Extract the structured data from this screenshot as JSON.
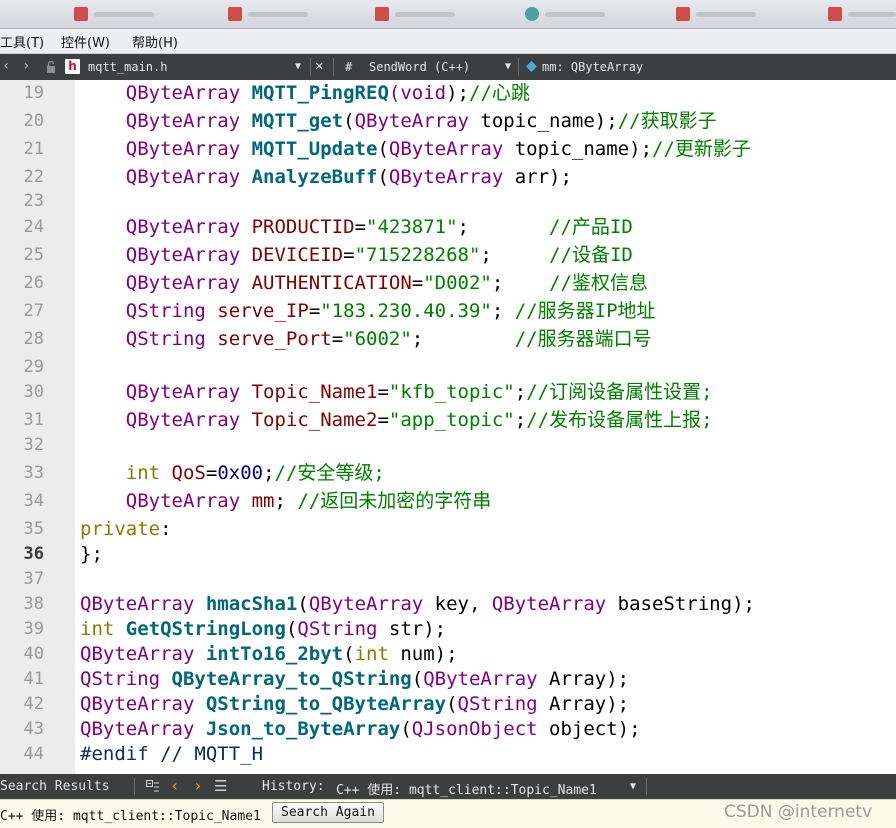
{
  "menu": [
    "工具(T)",
    "控件(W)",
    "帮助(H)"
  ],
  "editorbar": {
    "filename": "mqtt_main.h",
    "symbol_prefix": "#",
    "symbol": "SendWord (C++)",
    "member": "mm: QByteArray"
  },
  "code_lines": [
    {
      "n": "19",
      "current": false,
      "tokens": [
        [
          "    ",
          ""
        ],
        [
          "QByteArray",
          "type"
        ],
        [
          " ",
          ""
        ],
        [
          "MQTT_PingREQ",
          "func"
        ],
        [
          "(",
          "type"
        ],
        [
          "void",
          "type"
        ],
        [
          ");",
          ""
        ],
        [
          "//心跳",
          "com"
        ]
      ]
    },
    {
      "n": "20",
      "current": false,
      "tokens": [
        [
          "    ",
          ""
        ],
        [
          "QByteArray",
          "type"
        ],
        [
          " ",
          ""
        ],
        [
          "MQTT_get",
          "func"
        ],
        [
          "(",
          ""
        ],
        [
          "QByteArray",
          "type"
        ],
        [
          " topic_name);",
          ""
        ],
        [
          "//获取影子",
          "com"
        ]
      ]
    },
    {
      "n": "21",
      "current": false,
      "tokens": [
        [
          "    ",
          ""
        ],
        [
          "QByteArray",
          "type"
        ],
        [
          " ",
          ""
        ],
        [
          "MQTT_Update",
          "func"
        ],
        [
          "(",
          ""
        ],
        [
          "QByteArray",
          "type"
        ],
        [
          " topic_name);",
          ""
        ],
        [
          "//更新影子",
          "com"
        ]
      ]
    },
    {
      "n": "22",
      "current": false,
      "tokens": [
        [
          "    ",
          ""
        ],
        [
          "QByteArray",
          "type"
        ],
        [
          " ",
          ""
        ],
        [
          "AnalyzeBuff",
          "func"
        ],
        [
          "(",
          ""
        ],
        [
          "QByteArray",
          "type"
        ],
        [
          " arr);",
          ""
        ]
      ]
    },
    {
      "n": "23",
      "current": false,
      "tokens": []
    },
    {
      "n": "24",
      "current": false,
      "tokens": [
        [
          "    ",
          ""
        ],
        [
          "QByteArray",
          "type"
        ],
        [
          " ",
          ""
        ],
        [
          "PRODUCTID",
          "var"
        ],
        [
          "=",
          ""
        ],
        [
          "\"423871\"",
          "str"
        ],
        [
          ";       ",
          ""
        ],
        [
          "//产品ID",
          "com"
        ]
      ]
    },
    {
      "n": "25",
      "current": false,
      "tokens": [
        [
          "    ",
          ""
        ],
        [
          "QByteArray",
          "type"
        ],
        [
          " ",
          ""
        ],
        [
          "DEVICEID",
          "var"
        ],
        [
          "=",
          ""
        ],
        [
          "\"715228268\"",
          "str"
        ],
        [
          ";     ",
          ""
        ],
        [
          "//设备ID",
          "com"
        ]
      ]
    },
    {
      "n": "26",
      "current": false,
      "tokens": [
        [
          "    ",
          ""
        ],
        [
          "QByteArray",
          "type"
        ],
        [
          " ",
          ""
        ],
        [
          "AUTHENTICATION",
          "var"
        ],
        [
          "=",
          ""
        ],
        [
          "\"D002\"",
          "str"
        ],
        [
          ";    ",
          ""
        ],
        [
          "//鉴权信息",
          "com"
        ]
      ]
    },
    {
      "n": "27",
      "current": false,
      "tokens": [
        [
          "    ",
          ""
        ],
        [
          "QString",
          "type"
        ],
        [
          " ",
          ""
        ],
        [
          "serve_IP",
          "var"
        ],
        [
          "=",
          ""
        ],
        [
          "\"183.230.40.39\"",
          "str"
        ],
        [
          "; ",
          ""
        ],
        [
          "//服务器IP地址",
          "com"
        ]
      ]
    },
    {
      "n": "28",
      "current": false,
      "tokens": [
        [
          "    ",
          ""
        ],
        [
          "QString",
          "type"
        ],
        [
          " ",
          ""
        ],
        [
          "serve_Port",
          "var"
        ],
        [
          "=",
          ""
        ],
        [
          "\"6002\"",
          "str"
        ],
        [
          ";        ",
          ""
        ],
        [
          "//服务器端口号",
          "com"
        ]
      ]
    },
    {
      "n": "29",
      "current": false,
      "tokens": []
    },
    {
      "n": "30",
      "current": false,
      "tokens": [
        [
          "    ",
          ""
        ],
        [
          "QByteArray",
          "type"
        ],
        [
          " ",
          ""
        ],
        [
          "Topic_Name1",
          "var"
        ],
        [
          "=",
          ""
        ],
        [
          "\"kfb_topic\"",
          "str"
        ],
        [
          ";",
          ""
        ],
        [
          "//订阅设备属性设置;",
          "com"
        ]
      ]
    },
    {
      "n": "31",
      "current": false,
      "tokens": [
        [
          "    ",
          ""
        ],
        [
          "QByteArray",
          "type"
        ],
        [
          " ",
          ""
        ],
        [
          "Topic_Name2",
          "var"
        ],
        [
          "=",
          ""
        ],
        [
          "\"app_topic\"",
          "str"
        ],
        [
          ";",
          ""
        ],
        [
          "//发布设备属性上报;",
          "com"
        ]
      ]
    },
    {
      "n": "32",
      "current": false,
      "tokens": []
    },
    {
      "n": "33",
      "current": false,
      "tokens": [
        [
          "    ",
          ""
        ],
        [
          "int",
          "kw"
        ],
        [
          " ",
          ""
        ],
        [
          "QoS",
          "var"
        ],
        [
          "=",
          ""
        ],
        [
          "0x00",
          "num"
        ],
        [
          ";",
          ""
        ],
        [
          "//安全等级;",
          "com"
        ]
      ]
    },
    {
      "n": "34",
      "current": false,
      "tokens": [
        [
          "    ",
          ""
        ],
        [
          "QByteArray",
          "type"
        ],
        [
          " ",
          ""
        ],
        [
          "mm",
          "var"
        ],
        [
          "; ",
          ""
        ],
        [
          "//返回未加密的字符串",
          "com"
        ]
      ]
    },
    {
      "n": "35",
      "current": false,
      "tokens": [
        [
          "private",
          "kw"
        ],
        [
          ":",
          ""
        ]
      ]
    },
    {
      "n": "36",
      "current": true,
      "tokens": [
        [
          "};",
          ""
        ]
      ]
    },
    {
      "n": "37",
      "current": false,
      "tokens": []
    },
    {
      "n": "38",
      "current": false,
      "tokens": [
        [
          "QByteArray",
          "type"
        ],
        [
          " ",
          ""
        ],
        [
          "hmacSha1",
          "func"
        ],
        [
          "(",
          ""
        ],
        [
          "QByteArray",
          "type"
        ],
        [
          " key, ",
          ""
        ],
        [
          "QByteArray",
          "type"
        ],
        [
          " baseString);",
          ""
        ]
      ]
    },
    {
      "n": "39",
      "current": false,
      "tokens": [
        [
          "int",
          "kw"
        ],
        [
          " ",
          ""
        ],
        [
          "GetQStringLong",
          "func"
        ],
        [
          "(",
          ""
        ],
        [
          "QString",
          "type"
        ],
        [
          " str);",
          ""
        ]
      ]
    },
    {
      "n": "40",
      "current": false,
      "tokens": [
        [
          "QByteArray",
          "type"
        ],
        [
          " ",
          ""
        ],
        [
          "intTo16_2byt",
          "func"
        ],
        [
          "(",
          ""
        ],
        [
          "int",
          "kw"
        ],
        [
          " num);",
          ""
        ]
      ]
    },
    {
      "n": "41",
      "current": false,
      "tokens": [
        [
          "QString",
          "type"
        ],
        [
          " ",
          ""
        ],
        [
          "QByteArray_to_QString",
          "func"
        ],
        [
          "(",
          ""
        ],
        [
          "QByteArray",
          "type"
        ],
        [
          " Array);",
          ""
        ]
      ]
    },
    {
      "n": "42",
      "current": false,
      "tokens": [
        [
          "QByteArray",
          "type"
        ],
        [
          " ",
          ""
        ],
        [
          "QString_to_QByteArray",
          "func"
        ],
        [
          "(",
          ""
        ],
        [
          "QString",
          "type"
        ],
        [
          " Array);",
          ""
        ]
      ]
    },
    {
      "n": "43",
      "current": false,
      "tokens": [
        [
          "QByteArray",
          "type"
        ],
        [
          " ",
          ""
        ],
        [
          "Json_to_ByteArray",
          "func"
        ],
        [
          "(",
          ""
        ],
        [
          "QJsonObject",
          "type"
        ],
        [
          " object);",
          ""
        ]
      ]
    },
    {
      "n": "44",
      "current": false,
      "tokens": [
        [
          "#endif",
          "id"
        ],
        [
          " ",
          ""
        ],
        [
          "// MQTT_H",
          "id"
        ]
      ]
    }
  ],
  "searchbar": {
    "title": "Search Results",
    "history_label": "History:",
    "history_value": "C++ 使用: mqtt_client::Topic_Name1"
  },
  "status": {
    "text": "C++ 使用: mqtt_client::Topic_Name1",
    "button": "Search Again",
    "watermark": "CSDN @internetv"
  },
  "colors": {
    "type": "#800080",
    "func": "#00677c",
    "string": "#008000",
    "comment": "#008000",
    "keyword": "#808000"
  }
}
